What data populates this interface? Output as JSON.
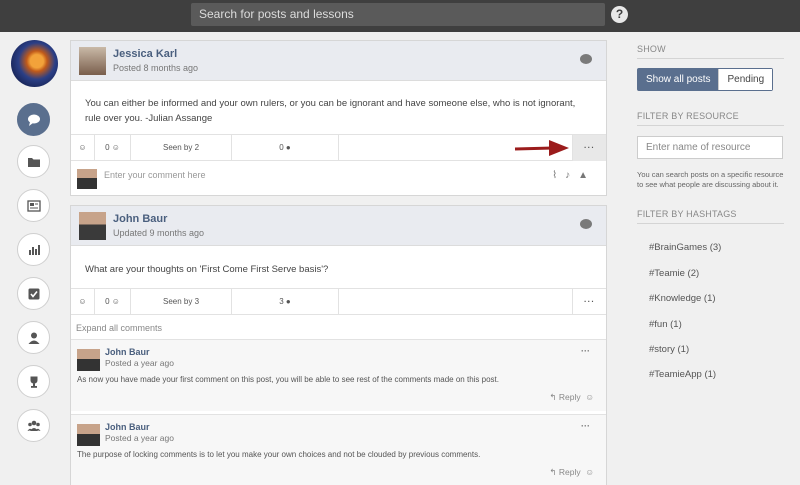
{
  "topbar": {
    "search_placeholder": "Search for posts and lessons",
    "help_glyph": "?"
  },
  "sidebar": {
    "icons": [
      "chat-icon",
      "folder-icon",
      "newspaper-icon",
      "bar-chart-icon",
      "checkbox-icon",
      "user-icon",
      "trophy-icon",
      "group-icon"
    ]
  },
  "posts": [
    {
      "author": "Jessica Karl",
      "meta": "Posted 8 months ago",
      "body_line1": "You can either be informed and your own rulers, or you can be ignorant and have someone else, who is not ignorant,",
      "body_line2": "rule over you. -Julian Assange",
      "likes": "0",
      "seen": "Seen by 2",
      "comments": "0",
      "more": "···",
      "comment_placeholder": "Enter your comment here"
    },
    {
      "author": "John Baur",
      "meta": "Updated 9 months ago",
      "body_line1": "What are your thoughts on 'First Come First Serve basis'?",
      "likes": "0",
      "seen": "Seen by 3",
      "comments": "3",
      "more": "···",
      "expand_label": "Expand all comments",
      "comments_list": [
        {
          "author": "John Baur",
          "meta": "Posted a year ago",
          "text": "As now you have made your first comment on this post, you will be able to see rest of the comments made on this post.",
          "reply": "Reply"
        },
        {
          "author": "John Baur",
          "meta": "Posted a year ago",
          "text": "The purpose of locking comments is to let you make your own choices and not be clouded by previous comments.",
          "reply": "Reply"
        }
      ]
    }
  ],
  "right_panel": {
    "show_title": "SHOW",
    "show_all": "Show all posts",
    "pending": "Pending",
    "filter_resource_title": "FILTER BY RESOURCE",
    "resource_placeholder": "Enter name of resource",
    "resource_note": "You can search posts on a specific resource to see what people are discussing about it.",
    "filter_hashtags_title": "FILTER BY HASHTAGS",
    "hashtags": [
      "#BrainGames (3)",
      "#Teamie (2)",
      "#Knowledge (1)",
      "#fun (1)",
      "#story (1)",
      "#TeamieApp (1)"
    ]
  },
  "colors": {
    "accent": "#5a6f8e",
    "topbar": "#3f3f3f",
    "arrow": "#9b1c1c"
  }
}
